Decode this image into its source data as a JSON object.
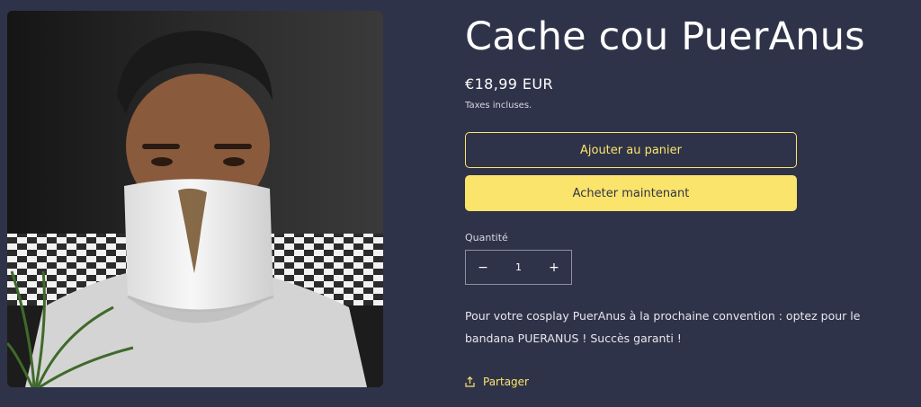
{
  "product": {
    "title": "Cache cou PuerAnus",
    "price": "€18,99 EUR",
    "tax_note": "Taxes incluses.",
    "image_alt": "Homme portant un cache-cou blanc avec une trace marron"
  },
  "actions": {
    "add_to_cart": "Ajouter au panier",
    "buy_now": "Acheter maintenant"
  },
  "quantity": {
    "label": "Quantité",
    "value": "1",
    "decrease_symbol": "−",
    "increase_symbol": "+"
  },
  "description": "Pour votre cosplay PuerAnus à la prochaine convention : optez pour le bandana PUERANUS ! Succès garanti !",
  "share": {
    "label": "Partager",
    "icon": "share-icon"
  },
  "colors": {
    "background": "#2f3349",
    "accent": "#fbe46b",
    "text": "#ffffff"
  }
}
